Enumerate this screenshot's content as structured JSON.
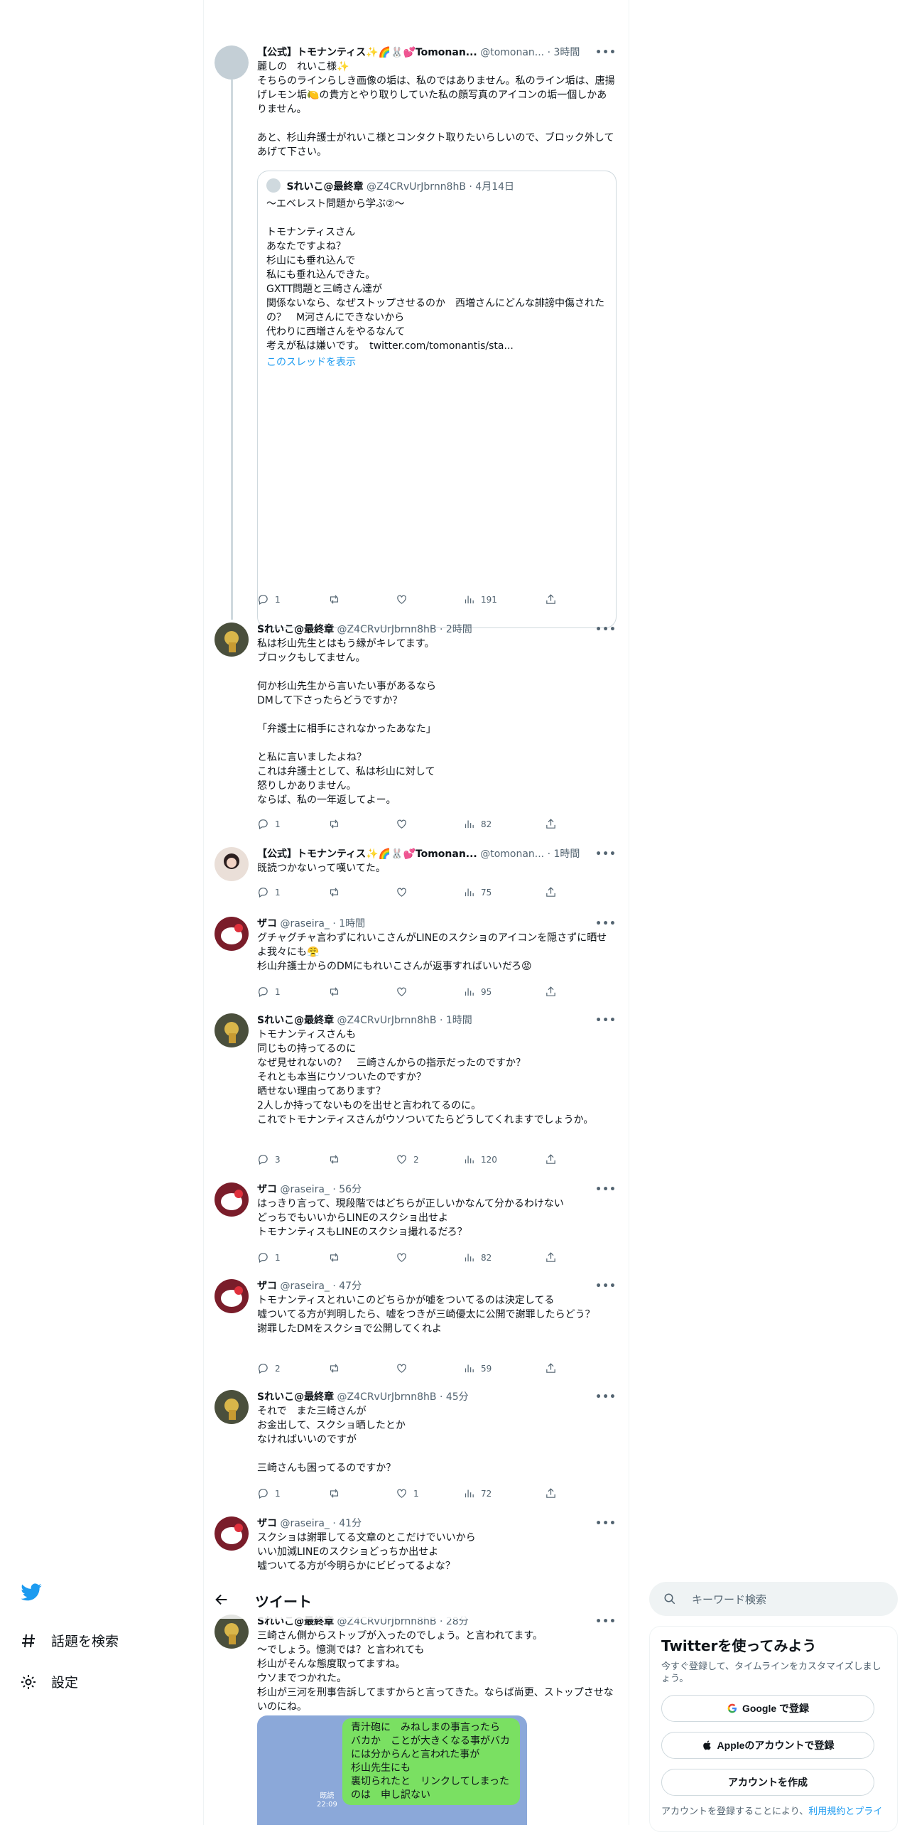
{
  "header": {
    "back_label": "←",
    "title": "ツイート"
  },
  "sidebar": {
    "items": [
      {
        "label": "話題を検索",
        "icon": "hashtag-icon"
      },
      {
        "label": "設定",
        "icon": "gear-icon"
      }
    ]
  },
  "search": {
    "placeholder": "キーワード検索"
  },
  "signup": {
    "title": "Twitterを使ってみよう",
    "subtitle": "今すぐ登録して、タイムラインをカスタマイズしましょう。",
    "google_button": "Google で登録",
    "apple_button": "Appleのアカウントで登録",
    "create_button": "アカウントを作成",
    "terms_prefix": "アカウントを登録することにより、",
    "terms_link": "利用規約とプライ"
  },
  "tweets": [
    {
      "name": "【公式】トモナンティス✨🌈🐰💕Tomonan...",
      "handle": "@tomonan...",
      "time": "· 3時間",
      "text": "麗しの　れいこ様✨\nそちらのラインらしき画像の垢は、私のではありません。私のライン垢は、唐揚げレモン垢🍋の貴方とやり取りしていた私の顔写真のアイコンの垢一個しかありません。\n\nあと、杉山弁護士がれいこ様とコンタクト取りたいらしいので、ブロック外してあげて下さい。",
      "quote": {
        "name": "Sれいこ@最終章",
        "handle": "@Z4CRvUrJbrnn8hB",
        "time": "· 4月14日",
        "text": "〜エベレスト問題から学ぶ②〜\n\nトモナンティスさん\nあなたですよね？\n杉山にも垂れ込んで\n私にも垂れ込んできた。\nGXTT問題と三崎さん達が\n関係ないなら、なぜストップさせるのか　西増さんにどんな誹謗中傷されたの？　M河さんにできないから\n代わりに西増さんをやるなんて\n考えが私は嫌いです。　twitter.com/tomonantis/sta...",
        "link": "このスレッドを表示"
      },
      "stats": {
        "replies": "1",
        "retweets": "",
        "likes": "",
        "views": "191"
      }
    },
    {
      "name": "Sれいこ@最終章",
      "handle": "@Z4CRvUrJbrnn8hB",
      "time": "· 2時間",
      "text": "私は杉山先生とはもう縁がキレてます。\nブロックもしてません。\n\n何か杉山先生から言いたい事があるなら\nDMして下さったらどうですか？\n\n「弁護士に相手にされなかったあなた」\n\nと私に言いましたよね？\nこれは弁護士として、私は杉山に対して\n怒りしかありません。\nならば、私の一年返してよー。",
      "stats": {
        "replies": "1",
        "retweets": "",
        "likes": "",
        "views": "82"
      }
    },
    {
      "name": "【公式】トモナンティス✨🌈🐰💕Tomonan...",
      "handle": "@tomonan...",
      "time": "· 1時間",
      "text": "既読つかないって嘆いてた。",
      "stats": {
        "replies": "1",
        "retweets": "",
        "likes": "",
        "views": "75"
      }
    },
    {
      "name": "ザコ",
      "handle": "@raseira_",
      "time": "· 1時間",
      "text": "グチャグチャ言わずにれいこさんがLINEのスクショのアイコンを隠さずに晒せよ我々にも😤\n杉山弁護士からのDMにもれいこさんが返事すればいいだろ😡",
      "stats": {
        "replies": "1",
        "retweets": "",
        "likes": "",
        "views": "95"
      }
    },
    {
      "name": "Sれいこ@最終章",
      "handle": "@Z4CRvUrJbrnn8hB",
      "time": "· 1時間",
      "text": "トモナンティスさんも\n同じもの持ってるのに\nなぜ見せれないの？　三崎さんからの指示だったのですか？\nそれとも本当にウソついたのですか？\n晒せない理由ってあります？\n2人しか持ってないものを出せと言われてるのに。\nこれでトモナンティスさんがウソついてたらどうしてくれますでしょうか。",
      "stats": {
        "replies": "3",
        "retweets": "",
        "likes": "2",
        "views": "120"
      }
    },
    {
      "name": "ザコ",
      "handle": "@raseira_",
      "time": "· 56分",
      "text": "はっきり言って、現段階ではどちらが正しいかなんて分かるわけない\nどっちでもいいからLINEのスクショ出せよ\nトモナンティスもLINEのスクショ撮れるだろ？",
      "stats": {
        "replies": "1",
        "retweets": "",
        "likes": "",
        "views": "82"
      }
    },
    {
      "name": "ザコ",
      "handle": "@raseira_",
      "time": "· 47分",
      "text": "トモナンティスとれいこのどちらかが嘘をついてるのは決定してる\n嘘ついてる方が判明したら、嘘をつきが三崎優太に公開で謝罪したらどう？\n謝罪したDMをスクショで公開してくれよ",
      "stats": {
        "replies": "2",
        "retweets": "",
        "likes": "",
        "views": "59"
      }
    },
    {
      "name": "Sれいこ@最終章",
      "handle": "@Z4CRvUrJbrnn8hB",
      "time": "· 45分",
      "text": "それで　また三崎さんが\nお金出して、スクショ晒したとか\nなければいいのですが\n\n三崎さんも困ってるのですか？",
      "stats": {
        "replies": "1",
        "retweets": "",
        "likes": "1",
        "views": "72"
      }
    },
    {
      "name": "ザコ",
      "handle": "@raseira_",
      "time": "· 41分",
      "text": "スクショは謝罪してる文章のとこだけでいいから\nいい加減LINEのスクショどっちか出せよ\n嘘ついてる方が今明らかにビビってるよな？",
      "stats": {
        "replies": "",
        "retweets": "",
        "likes": "",
        "views": ""
      }
    },
    {
      "name": "Sれいこ@最終章",
      "handle": "@Z4CRvUrJbrnn8hB",
      "time": "· 28分",
      "text": "三崎さん側からストップが入ったのでしょう。と言われてます。\n〜でしょう。憶測では？と言われても\n杉山がそんな態度取ってますね。\nウソまでつかれた。\n杉山が三河を刑事告訴してますからと言ってきた。ならば尚更、ストップさせないのにね。",
      "image": {
        "bubble_text": "青汁砲に　みねしまの事言ったら\nバカか　ことが大きくなる事がバカには分からんと言われた事が\n杉山先生にも\n裏切られたと　リンクしてしまったのは　申し訳ない",
        "read_label": "既読",
        "time": "22:09"
      }
    }
  ],
  "colors": {
    "accent": "#1d9bf0",
    "text": "#0f1419",
    "muted": "#536471",
    "border": "#cfd9de"
  }
}
